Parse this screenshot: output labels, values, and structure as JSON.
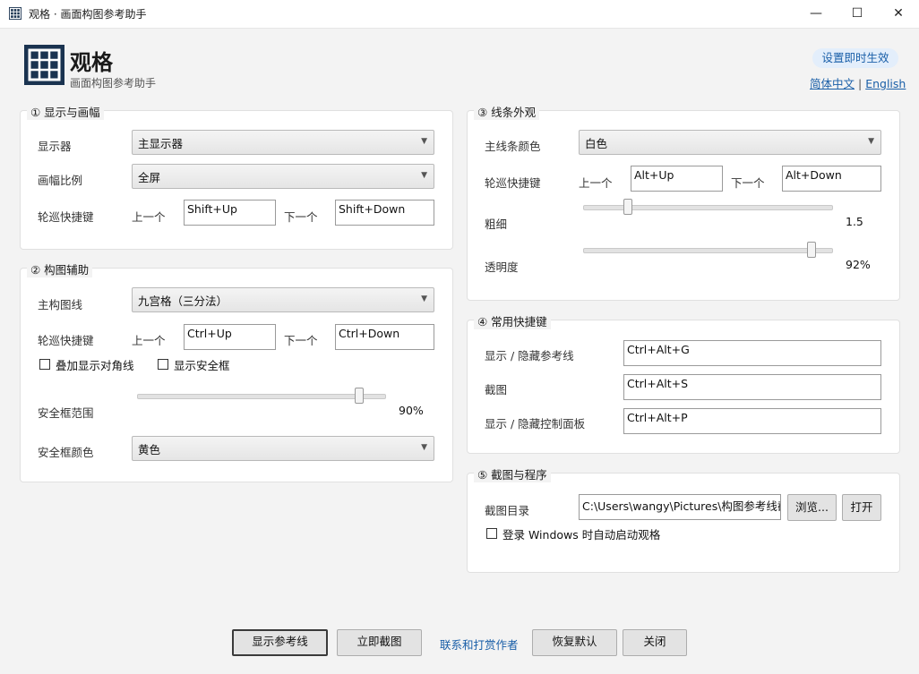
{
  "window": {
    "title": "观格 · 画面构图参考助手",
    "minimize": "—",
    "maximize": "☐",
    "close": "✕"
  },
  "header": {
    "app_name": "观格",
    "subtitle": "画面构图参考助手",
    "live_badge": "设置即时生效",
    "lang_zh": "简体中文",
    "lang_sep": "|",
    "lang_en": "English"
  },
  "display": {
    "title": "① 显示与画幅",
    "monitor_label": "显示器",
    "monitor_value": "主显示器",
    "ratio_label": "画幅比例",
    "ratio_value": "全屏",
    "hotkey_label": "轮巡快捷键",
    "prev_label": "上一个",
    "prev_value": "Shift+Up",
    "next_label": "下一个",
    "next_value": "Shift+Down"
  },
  "composition": {
    "title": "② 构图辅助",
    "main_label": "主构图线",
    "main_value": "九宫格（三分法）",
    "hotkey_label": "轮巡快捷键",
    "prev_label": "上一个",
    "prev_value": "Ctrl+Up",
    "next_label": "下一个",
    "next_value": "Ctrl+Down",
    "diagonal_label": "叠加显示对角线",
    "diagonal_checked": false,
    "safe_label": "显示安全框",
    "safe_checked": false,
    "safe_range_label": "安全框范围",
    "safe_range_value": "90%",
    "safe_range_fraction": 0.9,
    "safe_color_label": "安全框颜色",
    "safe_color_value": "黄色"
  },
  "line": {
    "title": "③ 线条外观",
    "color_label": "主线条颜色",
    "color_value": "白色",
    "hotkey_label": "轮巡快捷键",
    "prev_label": "上一个",
    "prev_value": "Alt+Up",
    "next_label": "下一个",
    "next_value": "Alt+Down",
    "width_label": "粗细",
    "width_value": "1.5",
    "width_fraction": 0.18,
    "opacity_label": "透明度",
    "opacity_value": "92%",
    "opacity_fraction": 0.92
  },
  "shortcuts": {
    "title": "④ 常用快捷键",
    "toggle_lines_label": "显示 / 隐藏参考线",
    "toggle_lines_value": "Ctrl+Alt+G",
    "screenshot_label": "截图",
    "screenshot_value": "Ctrl+Alt+S",
    "toggle_panel_label": "显示 / 隐藏控制面板",
    "toggle_panel_value": "Ctrl+Alt+P"
  },
  "capture": {
    "title": "⑤ 截图与程序",
    "dir_label": "截图目录",
    "dir_value": "C:\\Users\\wangy\\Pictures\\构图参考线截图",
    "browse_label": "浏览...",
    "open_label": "打开",
    "autostart_label": "登录 Windows 时自动启动观格",
    "autostart_checked": false
  },
  "footer": {
    "show_lines": "显示参考线",
    "capture_now": "立即截图",
    "contact": "联系和打赏作者",
    "restore": "恢复默认",
    "close": "关闭"
  },
  "colors": {
    "logo": "#1a3350",
    "link": "#1a5fa8",
    "badge_bg": "#e3eefb"
  }
}
